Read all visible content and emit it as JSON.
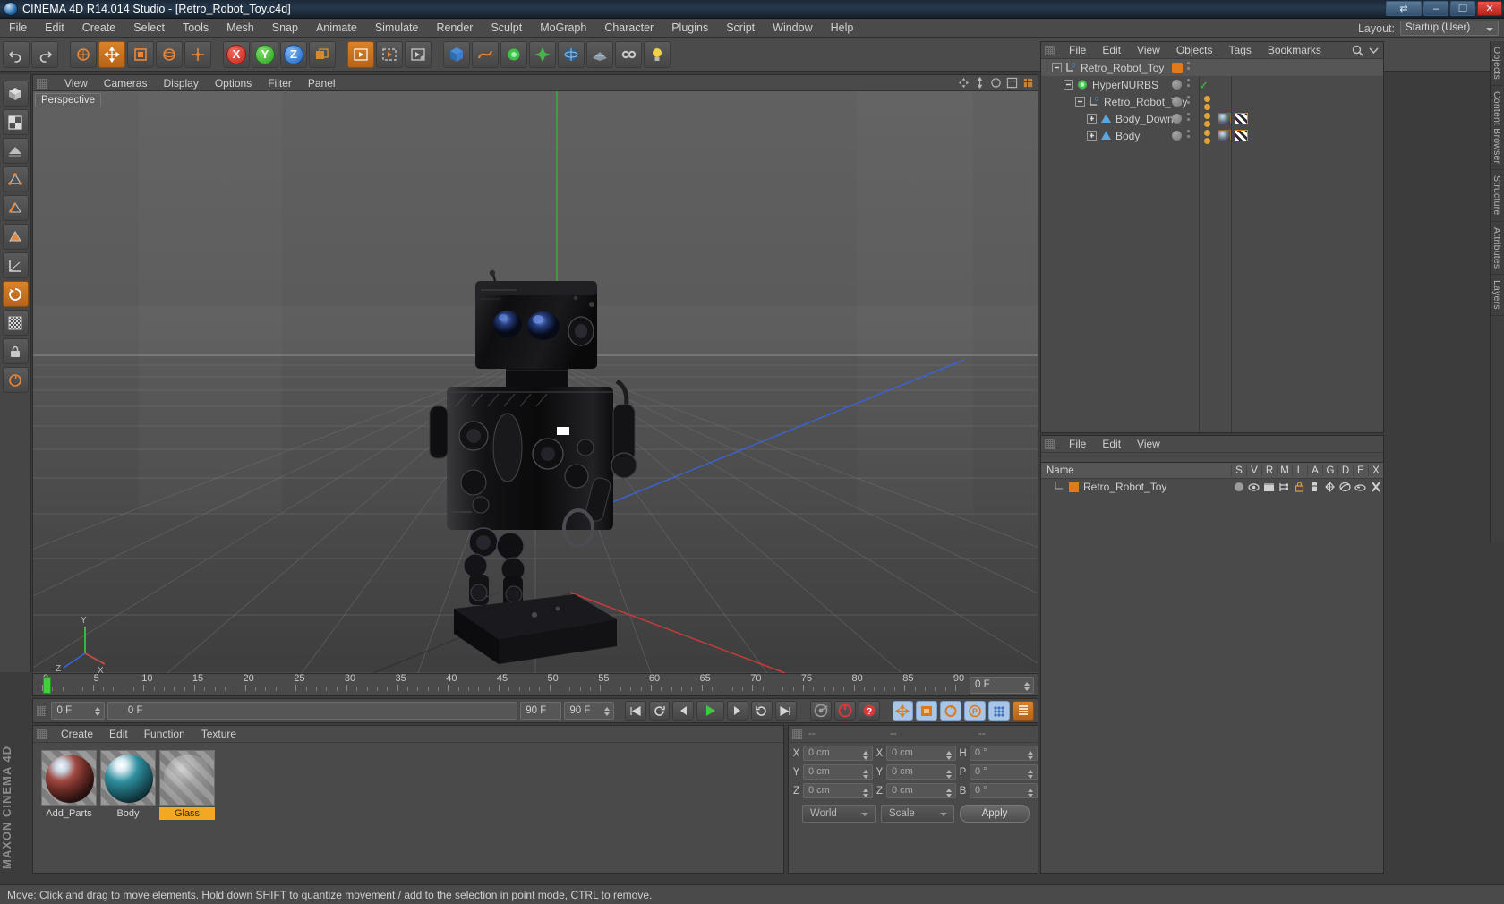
{
  "window": {
    "title": "CINEMA 4D R14.014 Studio - [Retro_Robot_Toy.c4d]",
    "app_icon": "c4d-logo-icon",
    "buttons": {
      "restore_dual": "⇄",
      "minimize": "–",
      "maximize": "❐",
      "close": "✕"
    }
  },
  "menubar": {
    "items": [
      "File",
      "Edit",
      "Create",
      "Select",
      "Tools",
      "Mesh",
      "Snap",
      "Animate",
      "Simulate",
      "Render",
      "Sculpt",
      "MoGraph",
      "Character",
      "Plugins",
      "Script",
      "Window",
      "Help"
    ],
    "layout_label": "Layout:",
    "layout_value": "Startup (User)"
  },
  "toolbar": {
    "groups": [
      {
        "name": "undo-redo",
        "buttons": [
          {
            "name": "undo-button",
            "glyph": "↶"
          },
          {
            "name": "redo-button",
            "glyph": "↷"
          }
        ]
      },
      {
        "name": "selection",
        "buttons": [
          {
            "name": "live-selection-button",
            "glyph": "⬤"
          },
          {
            "name": "move-button",
            "glyph": "✥",
            "active": true
          },
          {
            "name": "scale-button",
            "glyph": "■"
          },
          {
            "name": "rotate-button",
            "glyph": "↺"
          },
          {
            "name": "axis-button",
            "glyph": "✛"
          }
        ]
      },
      {
        "name": "axis-locks",
        "buttons": [
          {
            "name": "x-axis-lock-button",
            "glyph": "X"
          },
          {
            "name": "y-axis-lock-button",
            "glyph": "Y"
          },
          {
            "name": "z-axis-lock-button",
            "glyph": "Z"
          },
          {
            "name": "world-axis-button",
            "glyph": "⧉"
          }
        ]
      },
      {
        "name": "render",
        "buttons": [
          {
            "name": "render-view-button",
            "glyph": "▶"
          },
          {
            "name": "render-region-button",
            "glyph": "▶"
          },
          {
            "name": "render-settings-button",
            "glyph": "▶"
          }
        ]
      },
      {
        "name": "objects",
        "buttons": [
          {
            "name": "add-cube-button",
            "glyph": "▣"
          },
          {
            "name": "add-spline-button",
            "glyph": "∿"
          },
          {
            "name": "add-generator-button",
            "glyph": "⬡"
          },
          {
            "name": "add-deformer-button",
            "glyph": "✵"
          },
          {
            "name": "add-environment-button",
            "glyph": "●"
          },
          {
            "name": "add-floor-button",
            "glyph": "▱"
          },
          {
            "name": "add-camera-button",
            "glyph": "◎"
          },
          {
            "name": "add-light-button",
            "glyph": "●"
          }
        ]
      }
    ]
  },
  "left_palette": {
    "items": [
      {
        "name": "model-mode-tool",
        "glyph": "⬛"
      },
      {
        "name": "texture-mode-tool",
        "glyph": "▦"
      },
      {
        "name": "polygon-mode-tool",
        "glyph": "◧"
      },
      {
        "name": "points-mode-tool",
        "glyph": "⬚"
      },
      {
        "name": "edges-mode-tool",
        "glyph": "◿"
      },
      {
        "name": "polygons-mode-tool",
        "glyph": "△"
      },
      {
        "name": "workplane-tool",
        "glyph": "⌙"
      },
      {
        "name": "enable-axis-tool",
        "glyph": "↻",
        "active": true
      },
      {
        "name": "viewport-solo-tool",
        "glyph": "▒"
      },
      {
        "name": "lock-tool",
        "glyph": "⚿"
      },
      {
        "name": "quantize-tool",
        "glyph": "↺"
      }
    ]
  },
  "viewport": {
    "tag": "Perspective",
    "menu": [
      "View",
      "Cameras",
      "Display",
      "Options",
      "Filter",
      "Panel"
    ],
    "corner_icons": [
      "pan-icon",
      "zoom-icon",
      "rotate-icon",
      "maximize-icon",
      "config-icon"
    ],
    "axis_labels": {
      "x": "X",
      "y": "Y",
      "z": "Z"
    }
  },
  "timeline": {
    "ticks": [
      0,
      5,
      10,
      15,
      20,
      25,
      30,
      35,
      40,
      45,
      50,
      55,
      60,
      65,
      70,
      75,
      80,
      85,
      90
    ],
    "current_frame_field": "0 F",
    "playhead_frame": 0
  },
  "animbar": {
    "current_frame": "0 F",
    "start_frame": "0 F",
    "end_frame": "90 F",
    "preview_end": "90 F",
    "transport": [
      {
        "name": "go-to-start-button",
        "glyph": "⏮"
      },
      {
        "name": "play-back-loop-button",
        "glyph": "↺"
      },
      {
        "name": "step-back-button",
        "glyph": "◀"
      },
      {
        "name": "play-button",
        "glyph": "▶"
      },
      {
        "name": "step-forward-button",
        "glyph": "▶"
      },
      {
        "name": "play-forward-loop-button",
        "glyph": "↻"
      },
      {
        "name": "go-to-end-button",
        "glyph": "⏭"
      }
    ],
    "keyframe_tools": [
      {
        "name": "record-active-objects-button",
        "glyph": "◉"
      },
      {
        "name": "autokeying-button",
        "glyph": "○"
      },
      {
        "name": "keyframe-selection-button",
        "glyph": "?"
      },
      {
        "name": "position-key-button",
        "glyph": "✥"
      },
      {
        "name": "scale-key-button",
        "glyph": "▣"
      },
      {
        "name": "rotation-key-button",
        "glyph": "↻"
      },
      {
        "name": "parameter-key-button",
        "glyph": "P"
      },
      {
        "name": "point-level-animation-button",
        "glyph": "∷"
      },
      {
        "name": "animation-layer-button",
        "glyph": "☰"
      }
    ]
  },
  "material_manager": {
    "menu": [
      "Create",
      "Edit",
      "Function",
      "Texture"
    ],
    "materials": [
      {
        "name": "Add_Parts",
        "selected": false
      },
      {
        "name": "Body",
        "selected": false
      },
      {
        "name": "Glass",
        "selected": true
      }
    ]
  },
  "coordinate_manager": {
    "headers": [
      "--",
      "--",
      "--"
    ],
    "rows": [
      {
        "axis": "X",
        "position": "0 cm",
        "axis2": "X",
        "size": "0 cm",
        "axis3": "H",
        "rotation": "0 °"
      },
      {
        "axis": "Y",
        "position": "0 cm",
        "axis2": "Y",
        "size": "0 cm",
        "axis3": "P",
        "rotation": "0 °"
      },
      {
        "axis": "Z",
        "position": "0 cm",
        "axis2": "Z",
        "size": "0 cm",
        "axis3": "B",
        "rotation": "0 °"
      }
    ],
    "coord_system": "World",
    "size_mode": "Scale",
    "apply_label": "Apply"
  },
  "object_manager": {
    "menu": [
      "File",
      "Edit",
      "View",
      "Objects",
      "Tags",
      "Bookmarks"
    ],
    "search_icon": "magnifier-icon",
    "items": [
      {
        "label": "Retro_Robot_Toy",
        "depth": 0,
        "icon": "null-object-icon",
        "dot_color": "#e07b1d",
        "selected": true,
        "check": false,
        "tags": []
      },
      {
        "label": "HyperNURBS",
        "depth": 1,
        "icon": "hypernurbs-icon",
        "dot_color": "#8a8a8a",
        "selected": false,
        "check": true,
        "tags": []
      },
      {
        "label": "Retro_Robot_Toy",
        "depth": 2,
        "icon": "null-object-icon",
        "dot_color": "#8a8a8a",
        "selected": false,
        "check": false,
        "tags": [
          "dot",
          "dot"
        ]
      },
      {
        "label": "Body_Down",
        "depth": 3,
        "icon": "polygon-object-icon",
        "dot_color": "#8a8a8a",
        "selected": false,
        "check": false,
        "tags": [
          "dot",
          "dot",
          "texture",
          "uv"
        ]
      },
      {
        "label": "Body",
        "depth": 3,
        "icon": "polygon-object-icon",
        "dot_color": "#8a8a8a",
        "selected": false,
        "check": false,
        "tags": [
          "dot",
          "dot",
          "texture",
          "uv"
        ]
      }
    ]
  },
  "attribute_manager": {
    "menu": [
      "File",
      "Edit",
      "View"
    ]
  },
  "layer_manager": {
    "columns": [
      "Name",
      "S",
      "V",
      "R",
      "M",
      "L",
      "A",
      "G",
      "D",
      "E",
      "X"
    ],
    "rows": [
      {
        "name": "Retro_Robot_Toy",
        "color": "#e07b1d",
        "cells": [
          "●",
          "▭",
          "☷",
          "⊢",
          "⚿",
          "▓",
          "⯁",
          "◐",
          "▭",
          "✖"
        ]
      }
    ]
  },
  "right_tabs": [
    "Objects",
    "Content Browser",
    "Structure",
    "Attributes",
    "Layers"
  ],
  "brand": "MAXON CINEMA 4D",
  "statusbar": {
    "text": "Move: Click and drag to move elements. Hold down SHIFT to quantize movement / add to the selection in point mode, CTRL to remove."
  }
}
